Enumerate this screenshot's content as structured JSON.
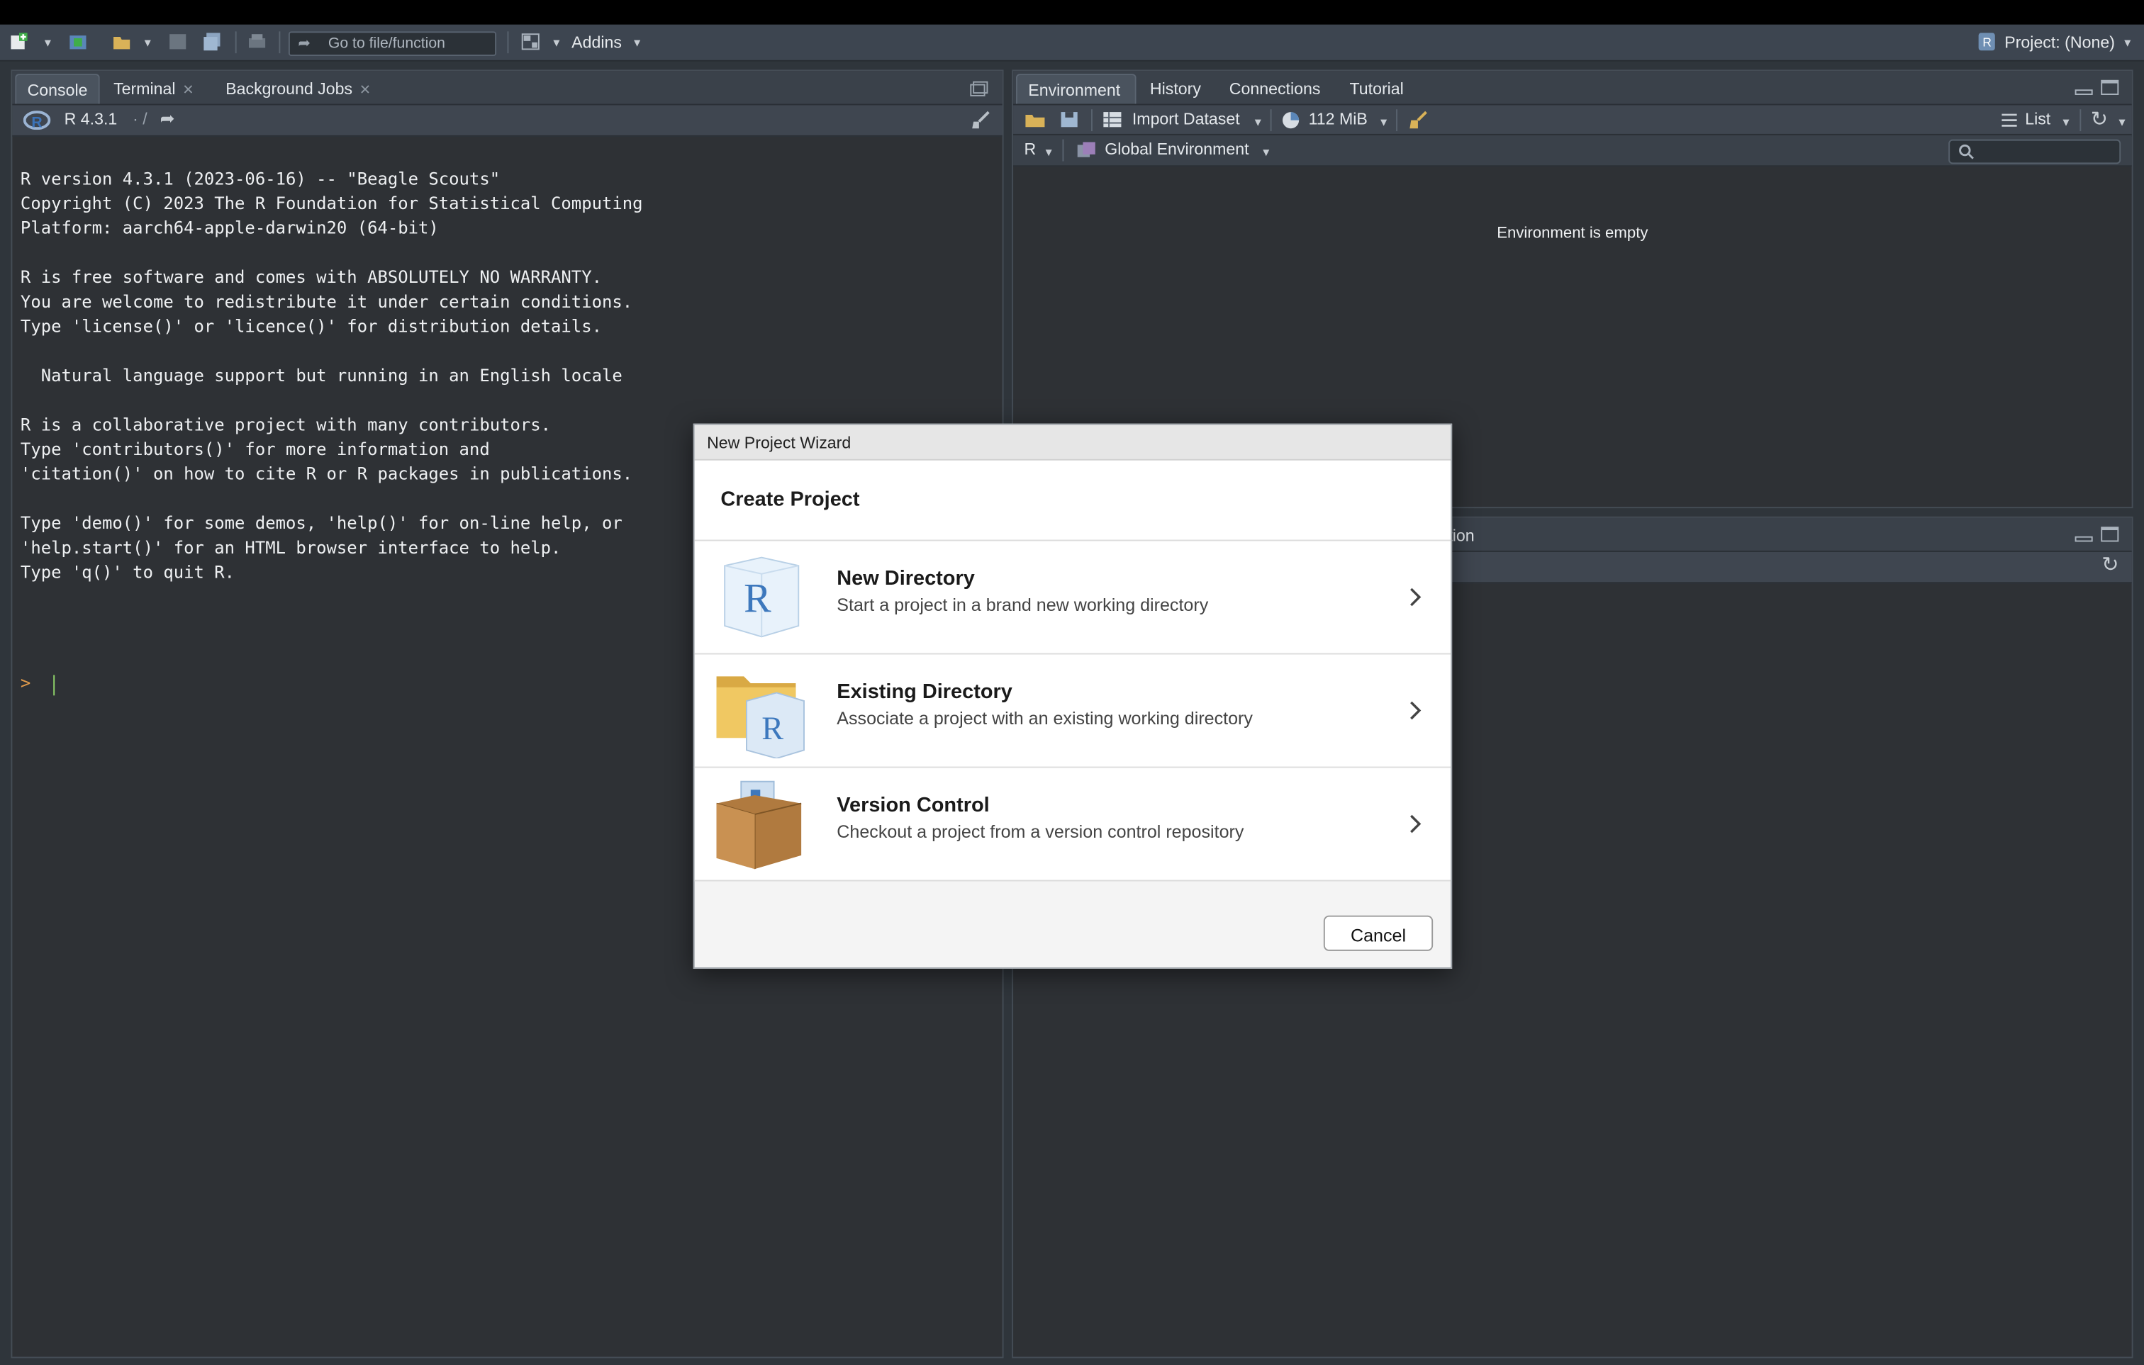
{
  "toolbar": {
    "goto_placeholder": "Go to file/function",
    "addins_label": "Addins",
    "project_label": "Project: (None)"
  },
  "console_pane": {
    "tabs": [
      "Console",
      "Terminal",
      "Background Jobs"
    ],
    "r_version_label": "R 4.3.1",
    "path_label": "· /",
    "output_lines": [
      "R version 4.3.1 (2023-06-16) -- \"Beagle Scouts\"",
      "Copyright (C) 2023 The R Foundation for Statistical Computing",
      "Platform: aarch64-apple-darwin20 (64-bit)",
      "",
      "R is free software and comes with ABSOLUTELY NO WARRANTY.",
      "You are welcome to redistribute it under certain conditions.",
      "Type 'license()' or 'licence()' for distribution details.",
      "",
      "  Natural language support but running in an English locale",
      "",
      "R is a collaborative project with many contributors.",
      "Type 'contributors()' for more information and",
      "'citation()' on how to cite R or R packages in publications.",
      "",
      "Type 'demo()' for some demos, 'help()' for on-line help, or",
      "'help.start()' for an HTML browser interface to help.",
      "Type 'q()' to quit R."
    ],
    "prompt": ">"
  },
  "env_pane": {
    "tabs": [
      "Environment",
      "History",
      "Connections",
      "Tutorial"
    ],
    "import_label": "Import Dataset",
    "memory_label": "112 MiB",
    "list_label": "List",
    "lang_label": "R",
    "scope_label": "Global Environment",
    "empty_message": "Environment is empty"
  },
  "files_pane": {
    "partial_tab_label": "tion"
  },
  "modal": {
    "window_title": "New Project Wizard",
    "heading": "Create Project",
    "options": [
      {
        "title": "New Directory",
        "description": "Start a project in a brand new working directory",
        "icon": "r-cube-icon"
      },
      {
        "title": "Existing Directory",
        "description": "Associate a project with an existing working directory",
        "icon": "folder-r-icon"
      },
      {
        "title": "Version Control",
        "description": "Checkout a project from a version control repository",
        "icon": "box-icon"
      }
    ],
    "cancel_label": "Cancel"
  }
}
